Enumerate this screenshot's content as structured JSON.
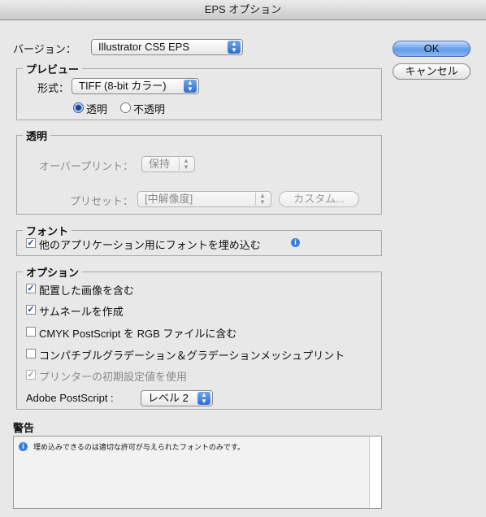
{
  "window": {
    "title": "EPS オプション"
  },
  "version": {
    "label": "バージョン：",
    "value": "Illustrator CS5 EPS"
  },
  "buttons": {
    "ok": "OK",
    "cancel": "キャンセル",
    "custom": "カスタム..."
  },
  "preview": {
    "title": "プレビュー",
    "format_label": "形式：",
    "format_value": "TIFF (8-bit カラー)",
    "transparent_label": "透明",
    "opaque_label": "不透明",
    "transparent_selected": true
  },
  "transparency": {
    "title": "透明",
    "overprint_label": "オーバープリント：",
    "overprint_value": "保持",
    "preset_label": "プリセット：",
    "preset_value": "[中解像度]"
  },
  "fonts": {
    "title": "フォント",
    "embed_label": "他のアプリケーション用にフォントを埋め込む",
    "embed_checked": true
  },
  "options": {
    "title": "オプション",
    "items": [
      {
        "label": "配置した画像を含む",
        "checked": true,
        "disabled": false
      },
      {
        "label": "サムネールを作成",
        "checked": true,
        "disabled": false
      },
      {
        "label": "CMYK PostScript を RGB ファイルに含む",
        "checked": false,
        "disabled": false
      },
      {
        "label": "コンパチブルグラデーション＆グラデーションメッシュプリント",
        "checked": false,
        "disabled": false
      },
      {
        "label": "プリンターの初期設定値を使用",
        "checked": true,
        "disabled": true
      }
    ],
    "postscript_label": "Adobe PostScript :",
    "postscript_value": "レベル 2"
  },
  "warnings": {
    "title": "警告",
    "message": "埋め込みできるのは適切な許可が与えられたフォントのみです。"
  },
  "icons": {
    "info": "info-icon",
    "popup_arrows": "updown-arrows-icon",
    "check": "checkmark-icon"
  }
}
